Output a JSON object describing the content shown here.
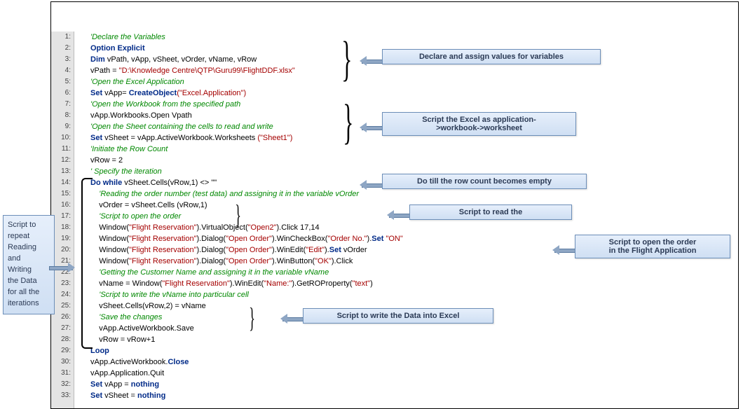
{
  "code": {
    "l1": {
      "cls": "comment",
      "text": "'Declare the Variables"
    },
    "l2k": "Option Explicit",
    "l3k": "Dim",
    "l3p": " vPath, vApp, vSheet, vOrder, vName, vRow",
    "l4p1": "vPath = ",
    "l4s": "\"D:\\Knowledge Centre\\QTP\\Guru99\\FlightDDF.xlsx\"",
    "l5": "'Open the Excel Application",
    "l6k1": "Set",
    "l6p": " vApp= ",
    "l6k2": "CreateObject",
    "l6s": "(\"Excel.Application\")",
    "l7": "'Open the Workbook from the specified path",
    "l8": "vApp.Workbooks.Open Vpath",
    "l9": "'Open the Sheet containing the cells to read and write",
    "l10k": "Set",
    "l10p": " vSheet = vApp.ActiveWorkbook.Worksheets ",
    "l10s": "(\"Sheet1\")",
    "l11": "'Initiate the Row Count",
    "l12": "vRow = 2",
    "l13": "' Specify the iteration",
    "l14k": "Do while",
    "l14p": " vSheet.Cells(vRow,1) <> \"\"",
    "l15": "    'Reading the order number (test data) and assigning it in the variable vOrder",
    "l16": "    vOrder = vSheet.Cells (vRow,1)",
    "l17": "    'Script to open the order",
    "l18a": "    Window(",
    "l18s1": "\"Flight Reservation\"",
    "l18b": ").VirtualObject(",
    "l18s2": "\"Open2\"",
    "l18c": ").Click 17,14",
    "l19a": "    Window(",
    "l19s1": "\"Flight Reservation\"",
    "l19b": ").Dialog(",
    "l19s2": "\"Open Order\"",
    "l19c": ").WinCheckBox(",
    "l19s3": "\"Order No.\"",
    "l19d": ").",
    "l19k": "Set",
    "l19s4": " \"ON\"",
    "l20a": "    Window(",
    "l20s1": "\"Flight Reservation\"",
    "l20b": ").Dialog(",
    "l20s2": "\"Open Order\"",
    "l20c": ").WinEdit(",
    "l20s3": "\"Edit\"",
    "l20d": ").",
    "l20k": "Set",
    "l20e": " vOrder",
    "l21a": "    Window(",
    "l21s1": "\"Flight Reservation\"",
    "l21b": ").Dialog(",
    "l21s2": "\"Open Order\"",
    "l21c": ").WinButton(",
    "l21s3": "\"OK\"",
    "l21d": ").Click",
    "l22": "    'Getting the Customer Name and assigning it in the variable vName",
    "l23a": "    vName = Window(",
    "l23s1": "\"Flight Reservation\"",
    "l23b": ").WinEdit(",
    "l23s2": "\"Name:\"",
    "l23c": ").GetROProperty(",
    "l23s3": "\"text\"",
    "l23d": ")",
    "l24": "    'Script to write the vName into particular cell",
    "l25": "    vSheet.Cells(vRow,2) = vName",
    "l26": "    'Save the changes",
    "l27": "    vApp.ActiveWorkbook.Save",
    "l28": "    vRow = vRow+1",
    "l29k": "Loop",
    "l30a": "vApp.ActiveWorkbook.",
    "l30k": "Close",
    "l31": "vApp.Application.Quit",
    "l32k": "Set",
    "l32p": " vApp = ",
    "l32k2": "nothing",
    "l33k": "Set",
    "l33p": " vSheet = ",
    "l33k2": "nothing"
  },
  "callouts": {
    "c1": "Declare and assign values for variables",
    "c2a": "Script the Excel as application-",
    "c2b": ">workbook->worksheet",
    "c3": "Do till the row count becomes empty",
    "c4": "Script to read the",
    "c5a": "Script to open the order",
    "c5b": "in the Flight Application",
    "c6": "Script to write the Data into Excel",
    "side": "Script to\nrepeat\nReading\nand\nWriting\nthe Data\nfor all the\niterations"
  }
}
